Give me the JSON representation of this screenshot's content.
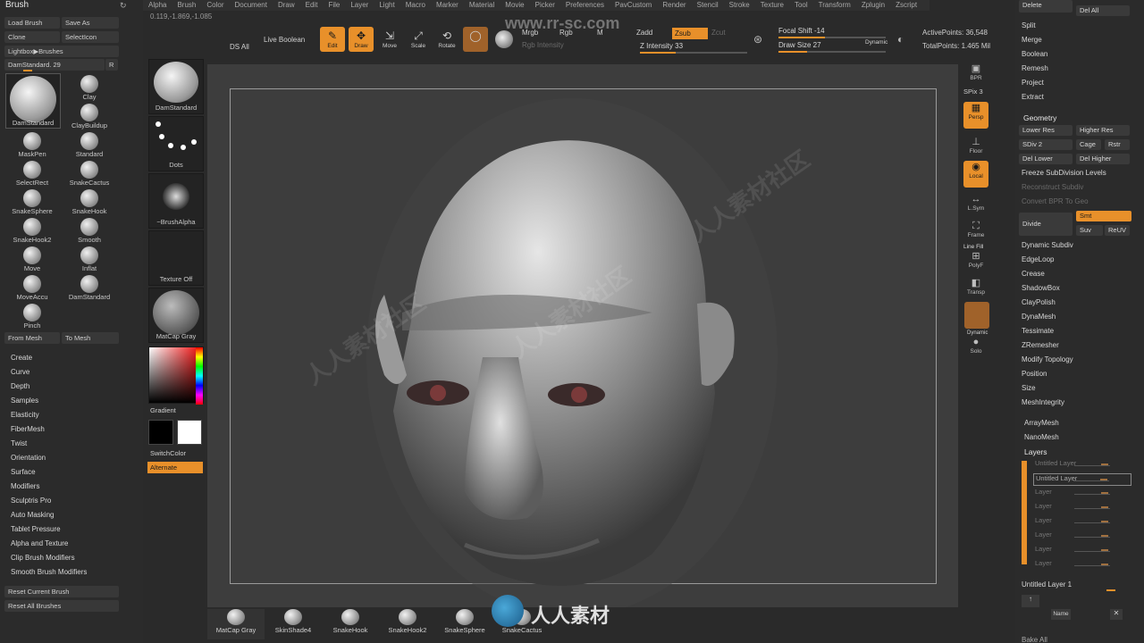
{
  "menu": [
    "Alpha",
    "Brush",
    "Color",
    "Document",
    "Draw",
    "Edit",
    "File",
    "Layer",
    "Light",
    "Macro",
    "Marker",
    "Material",
    "Movie",
    "Picker",
    "Preferences",
    "PavCustom",
    "Render",
    "Stencil",
    "Stroke",
    "Texture",
    "Tool",
    "Transform",
    "Zplugin",
    "Zscript"
  ],
  "coords": "0.119,-1.869,-1.085",
  "left": {
    "title": "Brush",
    "load_brush": "Load Brush",
    "save_as": "Save As",
    "clone": "Clone",
    "select_icon": "SelectIcon",
    "lightbox_brushes": "Lightbox▶Brushes",
    "current_brush": "DamStandard. 29",
    "r_btn": "R",
    "big_brush": "DamStandard",
    "brushes": [
      "Clay",
      "ClayBuildup",
      "Standard",
      "MaskPen",
      "SelectRect",
      "SnakeCactus",
      "SnakeSphere",
      "SnakeHook",
      "SnakeHook2",
      "Smooth",
      "Move",
      "Inflat",
      "MoveAccu",
      "DamStandard",
      "Pinch"
    ],
    "from_mesh": "From Mesh",
    "to_mesh": "To Mesh",
    "submenus": [
      "Create",
      "Curve",
      "Depth",
      "Samples",
      "Elasticity",
      "FiberMesh",
      "Twist",
      "Orientation",
      "Surface",
      "Modifiers",
      "Sculptris Pro",
      "Auto Masking",
      "Tablet Pressure",
      "Alpha and Texture",
      "Clip Brush Modifiers",
      "Smooth Brush Modifiers"
    ],
    "reset_current": "Reset Current Brush",
    "reset_all": "Reset All Brushes"
  },
  "thumbs": {
    "brush": "DamStandard",
    "stroke": "Dots",
    "alpha": "~BrushAlpha",
    "texture": "Texture Off",
    "material": "MatCap Gray",
    "gradient": "Gradient",
    "switch_color": "SwitchColor",
    "alternate": "Alternate"
  },
  "toolbar": {
    "ds_all": "DS All",
    "live_boolean": "Live Boolean",
    "edit": "Edit",
    "draw": "Draw",
    "move": "Move",
    "scale": "Scale",
    "rotate": "Rotate",
    "mrgb": "Mrgb",
    "rgb": "Rgb",
    "m": "M",
    "rgb_intensity": "Rgb Intensity",
    "zadd": "Zadd",
    "zsub": "Zsub",
    "zcut": "Zcut",
    "z_intensity": "Z Intensity 33",
    "focal_shift": "Focal Shift -14",
    "draw_size": "Draw Size 27",
    "dynamic": "Dynamic",
    "active_points": "ActivePoints: 36,548",
    "total_points": "TotalPoints: 1.465 Mil",
    "z_intensity_value": 33,
    "focal_shift_value": -14,
    "draw_size_value": 27
  },
  "shelf": {
    "bpr": "BPR",
    "spix": "SPix 3",
    "persp": "Persp",
    "floor": "Floor",
    "local": "Local",
    "lsym": "L.Sym",
    "frame": "Frame",
    "line_fill": "Line Fill",
    "polyf": "PolyF",
    "transp": "Transp",
    "dynamic": "Dynamic",
    "solo": "Solo"
  },
  "right": {
    "delete": "Delete",
    "del_all": "Del All",
    "split": "Split",
    "merge": "Merge",
    "boolean": "Boolean",
    "remesh": "Remesh",
    "project": "Project",
    "extract": "Extract",
    "geometry": "Geometry",
    "lower_res": "Lower Res",
    "higher_res": "Higher Res",
    "sdiv": "SDiv 2",
    "cage": "Cage",
    "rstr": "Rstr",
    "del_lower": "Del Lower",
    "del_higher": "Del Higher",
    "freeze": "Freeze SubDivision Levels",
    "reconstruct": "Reconstruct Subdiv",
    "convert_bpr": "Convert BPR To Geo",
    "divide": "Divide",
    "smt": "Smt",
    "suv": "Suv",
    "reuv": "ReUV",
    "geo_items": [
      "Dynamic Subdiv",
      "EdgeLoop",
      "Crease",
      "ShadowBox",
      "ClayPolish",
      "DynaMesh",
      "Tessimate",
      "ZRemesher",
      "Modify Topology",
      "Position",
      "Size",
      "MeshIntegrity"
    ],
    "array_mesh": "ArrayMesh",
    "nano_mesh": "NanoMesh",
    "layers": "Layers",
    "layer_rows": [
      "Untitled Layer",
      "Untitled Layer",
      "Layer",
      "Layer",
      "Layer",
      "Layer",
      "Layer",
      "Layer"
    ],
    "untitled_layer_1": "Untitled Layer 1",
    "name_btn": "Name",
    "bake_all": "Bake All"
  },
  "bottom": [
    "MatCap Gray",
    "SkinShade4",
    "SnakeHook",
    "SnakeHook2",
    "SnakeSphere",
    "SnakeCactus"
  ],
  "watermark": {
    "url": "www.rr-sc.com",
    "cn": "人人素材社区",
    "logo": "人人素材"
  },
  "colors": {
    "accent": "#e8902a",
    "bg": "#2a2a2a",
    "canvas": "#3d3d3d"
  }
}
